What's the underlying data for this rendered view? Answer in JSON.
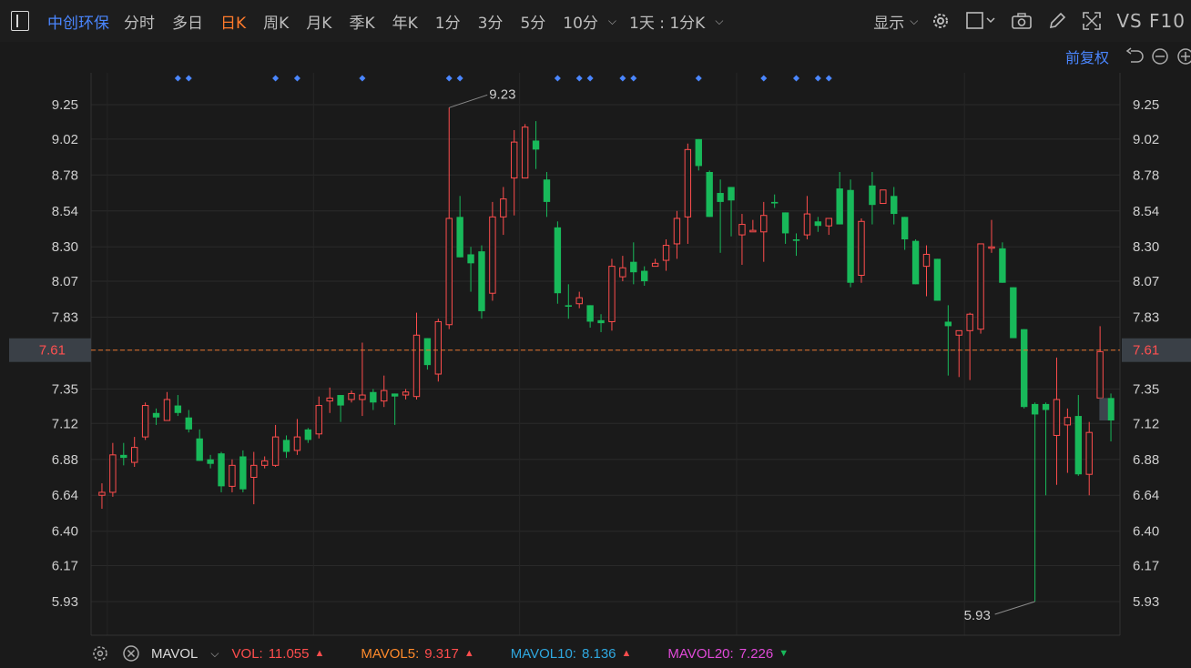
{
  "topbar": {
    "stock_name": "中创环保",
    "tabs": [
      "分时",
      "多日",
      "日K",
      "周K",
      "月K",
      "季K",
      "年K",
      "1分",
      "3分",
      "5分",
      "10分"
    ],
    "active_tab": "日K",
    "interval_label": "1天 : 1分K",
    "display_label": "显示",
    "vs_f10_label": "VS F10"
  },
  "adjust": {
    "label": "前复权"
  },
  "colors": {
    "up": "#ff4d4d",
    "down": "#18b95a",
    "accent": "#4a86ff",
    "active": "#ff7a2b"
  },
  "chart_data": {
    "type": "candlestick",
    "y_ticks": [
      "9.25",
      "9.02",
      "8.78",
      "8.54",
      "8.30",
      "8.07",
      "7.83",
      "7.61",
      "7.35",
      "7.12",
      "6.88",
      "6.64",
      "6.40",
      "6.17",
      "5.93"
    ],
    "ylim": [
      5.93,
      9.25
    ],
    "current_price": "7.61",
    "high_label": "9.23",
    "low_label": "5.93",
    "marker_days": [
      7,
      8,
      16,
      18,
      24,
      32,
      33,
      42,
      44,
      45,
      48,
      49,
      55,
      61,
      64,
      66,
      67
    ],
    "ohlc": [
      [
        6.64,
        6.66,
        6.55,
        6.72
      ],
      [
        6.66,
        6.91,
        6.63,
        6.99
      ],
      [
        6.91,
        6.89,
        6.84,
        6.99
      ],
      [
        6.86,
        6.96,
        6.83,
        7.03
      ],
      [
        7.03,
        7.24,
        7.01,
        7.26
      ],
      [
        7.19,
        7.16,
        7.11,
        7.22
      ],
      [
        7.14,
        7.28,
        7.14,
        7.33
      ],
      [
        7.24,
        7.19,
        7.17,
        7.31
      ],
      [
        7.16,
        7.08,
        7.06,
        7.21
      ],
      [
        7.02,
        6.87,
        6.87,
        7.08
      ],
      [
        6.88,
        6.85,
        6.82,
        6.91
      ],
      [
        6.92,
        6.7,
        6.66,
        6.93
      ],
      [
        6.7,
        6.84,
        6.66,
        6.88
      ],
      [
        6.9,
        6.68,
        6.66,
        6.94
      ],
      [
        6.76,
        6.84,
        6.58,
        6.93
      ],
      [
        6.84,
        6.87,
        6.82,
        6.9
      ],
      [
        6.84,
        7.03,
        6.83,
        7.11
      ],
      [
        7.01,
        6.93,
        6.89,
        7.04
      ],
      [
        6.94,
        7.03,
        6.91,
        7.15
      ],
      [
        7.08,
        7.01,
        6.99,
        7.09
      ],
      [
        7.05,
        7.24,
        7.02,
        7.3
      ],
      [
        7.27,
        7.29,
        7.19,
        7.36
      ],
      [
        7.31,
        7.24,
        7.13,
        7.3
      ],
      [
        7.28,
        7.32,
        7.26,
        7.34
      ],
      [
        7.28,
        7.31,
        7.17,
        7.66
      ],
      [
        7.33,
        7.26,
        7.21,
        7.35
      ],
      [
        7.27,
        7.34,
        7.23,
        7.44
      ],
      [
        7.32,
        7.3,
        7.11,
        7.32
      ],
      [
        7.31,
        7.33,
        7.28,
        7.35
      ],
      [
        7.3,
        7.71,
        7.28,
        7.86
      ],
      [
        7.69,
        7.51,
        7.48,
        7.69
      ],
      [
        7.45,
        7.8,
        7.4,
        7.82
      ],
      [
        7.78,
        8.49,
        7.75,
        9.23
      ],
      [
        8.5,
        8.23,
        8.23,
        8.64
      ],
      [
        8.25,
        8.19,
        8.0,
        8.3
      ],
      [
        8.27,
        7.87,
        7.82,
        8.31
      ],
      [
        7.99,
        8.5,
        7.94,
        8.6
      ],
      [
        8.5,
        8.62,
        8.38,
        8.7
      ],
      [
        8.76,
        9.0,
        8.51,
        9.08
      ],
      [
        8.76,
        9.1,
        8.9,
        9.12
      ],
      [
        9.01,
        8.95,
        8.82,
        9.14
      ],
      [
        8.75,
        8.6,
        8.5,
        8.8
      ],
      [
        8.43,
        7.99,
        7.92,
        8.47
      ],
      [
        7.91,
        7.9,
        7.82,
        8.05
      ],
      [
        7.92,
        7.96,
        7.89,
        8.0
      ],
      [
        7.91,
        7.8,
        7.76,
        7.9
      ],
      [
        7.81,
        7.79,
        7.73,
        7.85
      ],
      [
        7.8,
        8.17,
        7.74,
        8.22
      ],
      [
        8.1,
        8.16,
        8.07,
        8.24
      ],
      [
        8.2,
        8.13,
        8.05,
        8.33
      ],
      [
        8.14,
        8.07,
        8.04,
        8.17
      ],
      [
        8.17,
        8.19,
        8.17,
        8.22
      ],
      [
        8.21,
        8.31,
        8.14,
        8.35
      ],
      [
        8.32,
        8.49,
        8.22,
        8.54
      ],
      [
        8.5,
        8.95,
        8.32,
        8.99
      ],
      [
        9.02,
        8.84,
        8.81,
        8.98
      ],
      [
        8.8,
        8.5,
        8.5,
        8.81
      ],
      [
        8.66,
        8.6,
        8.26,
        8.75
      ],
      [
        8.7,
        8.61,
        8.37,
        8.67
      ],
      [
        8.38,
        8.45,
        8.18,
        8.52
      ],
      [
        8.4,
        8.41,
        8.4,
        8.48
      ],
      [
        8.4,
        8.51,
        8.2,
        8.6
      ],
      [
        8.6,
        8.59,
        8.56,
        8.65
      ],
      [
        8.53,
        8.39,
        8.32,
        8.53
      ],
      [
        8.35,
        8.34,
        8.24,
        8.39
      ],
      [
        8.38,
        8.52,
        8.35,
        8.64
      ],
      [
        8.47,
        8.44,
        8.4,
        8.5
      ],
      [
        8.44,
        8.49,
        8.38,
        8.48
      ],
      [
        8.69,
        8.45,
        8.45,
        8.8
      ],
      [
        8.68,
        8.06,
        8.03,
        8.75
      ],
      [
        8.11,
        8.47,
        8.06,
        8.49
      ],
      [
        8.71,
        8.58,
        8.45,
        8.8
      ],
      [
        8.59,
        8.68,
        8.7,
        8.58
      ],
      [
        8.64,
        8.52,
        8.45,
        8.7
      ],
      [
        8.5,
        8.35,
        8.28,
        8.5
      ],
      [
        8.34,
        8.05,
        8.05,
        8.35
      ],
      [
        8.17,
        8.25,
        7.97,
        8.31
      ],
      [
        8.22,
        7.94,
        8.0,
        8.17
      ],
      [
        7.8,
        7.77,
        7.44,
        7.91
      ],
      [
        7.71,
        7.74,
        7.43,
        7.74
      ],
      [
        7.74,
        7.85,
        7.41,
        7.86
      ],
      [
        7.75,
        8.32,
        7.72,
        8.3
      ],
      [
        8.3,
        8.3,
        8.26,
        8.48
      ],
      [
        8.29,
        8.06,
        8.06,
        8.33
      ],
      [
        8.03,
        7.69,
        7.8,
        8.01
      ],
      [
        7.75,
        7.23,
        7.22,
        7.73
      ],
      [
        7.25,
        7.18,
        5.93,
        7.26
      ],
      [
        7.25,
        7.21,
        6.64,
        7.26
      ],
      [
        7.04,
        7.28,
        6.71,
        7.56
      ],
      [
        7.11,
        7.16,
        6.79,
        7.22
      ],
      [
        7.17,
        6.78,
        6.77,
        7.31
      ],
      [
        6.78,
        7.06,
        6.64,
        7.13
      ],
      [
        7.29,
        7.6,
        7.28,
        7.77
      ],
      [
        7.29,
        7.14,
        7.0,
        7.32
      ]
    ],
    "volume_indicator": {
      "name": "MAVOL",
      "vol_label": "VOL:",
      "vol": "11.055",
      "ma5_label": "MAVOL5:",
      "ma5": "9.317",
      "ma10_label": "MAVOL10:",
      "ma10": "8.136",
      "ma20_label": "MAVOL20:",
      "ma20": "7.226"
    }
  }
}
